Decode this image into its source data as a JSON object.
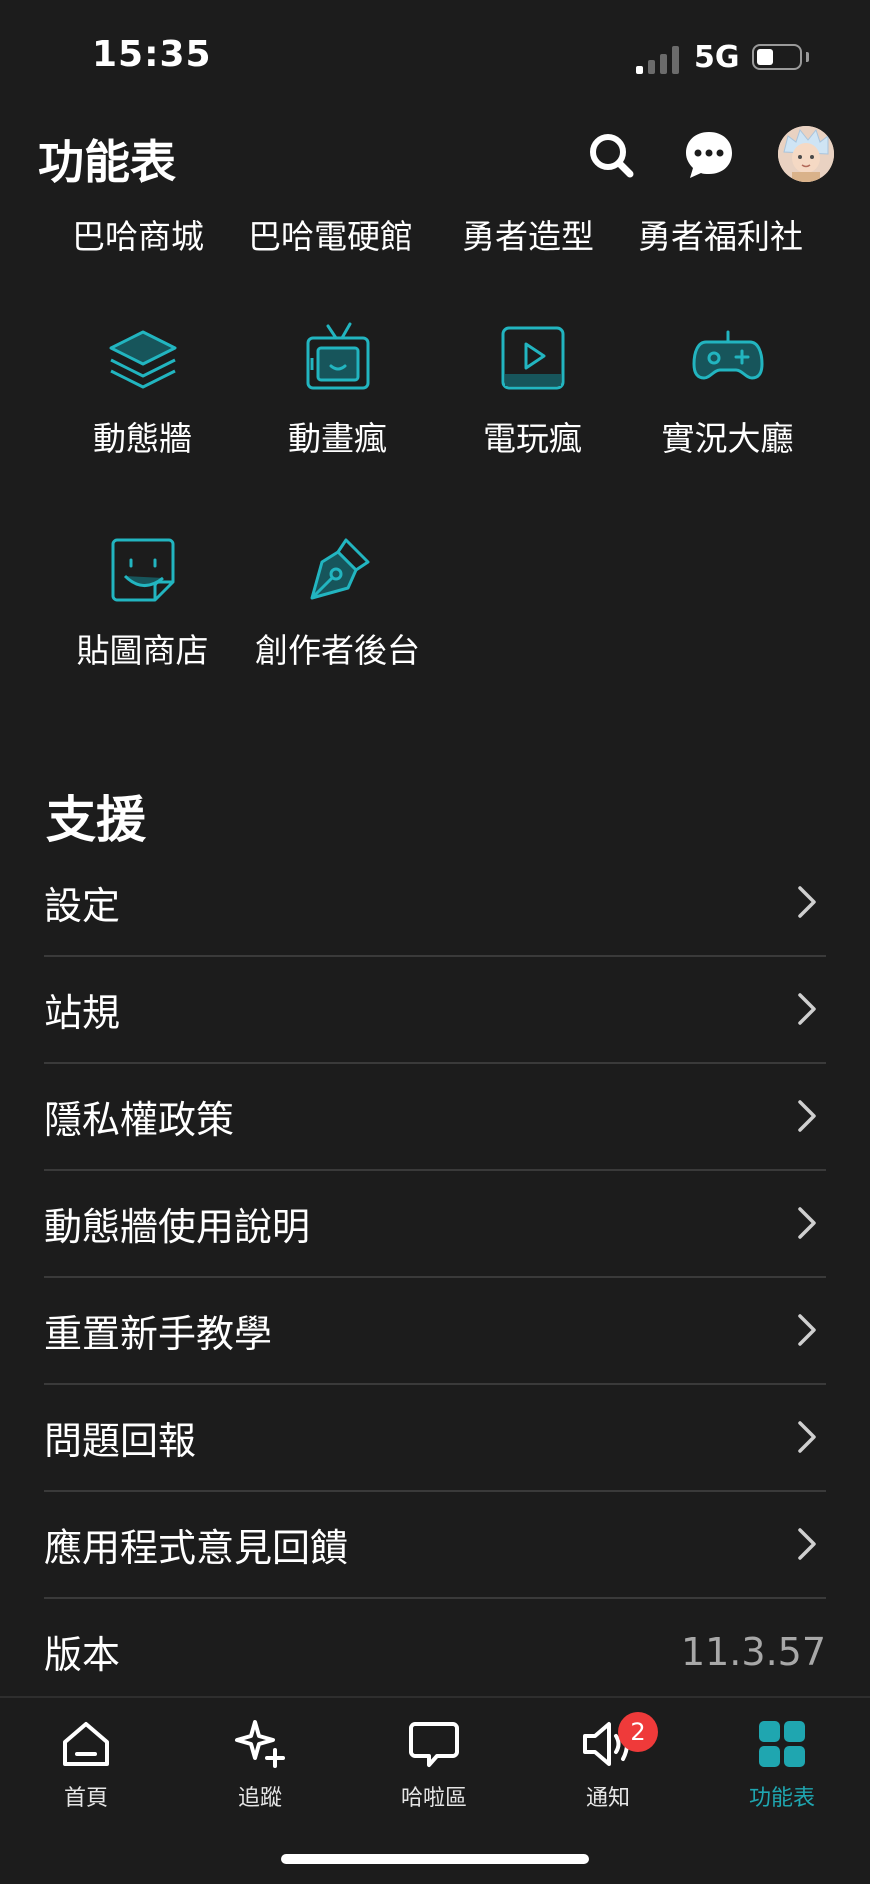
{
  "status_bar": {
    "time": "15:35",
    "network": "5G"
  },
  "header": {
    "title": "功能表"
  },
  "quick_links": [
    "巴哈商城",
    "巴哈電硬館",
    "勇者造型",
    "勇者福利社"
  ],
  "features": [
    {
      "label": "動態牆",
      "icon": "layers-icon"
    },
    {
      "label": "動畫瘋",
      "icon": "tv-icon"
    },
    {
      "label": "電玩瘋",
      "icon": "play-icon"
    },
    {
      "label": "實況大廳",
      "icon": "gamepad-icon"
    },
    {
      "label": "貼圖商店",
      "icon": "sticker-icon"
    },
    {
      "label": "創作者後台",
      "icon": "pen-nib-icon"
    }
  ],
  "support": {
    "title": "支援",
    "items": [
      "設定",
      "站規",
      "隱私權政策",
      "動態牆使用說明",
      "重置新手教學",
      "問題回報",
      "應用程式意見回饋"
    ],
    "version_label": "版本",
    "version_value": "11.3.57"
  },
  "tabs": [
    {
      "label": "首頁",
      "icon": "home-icon"
    },
    {
      "label": "追蹤",
      "icon": "sparkle-plus-icon"
    },
    {
      "label": "哈啦區",
      "icon": "chat-bubble-icon"
    },
    {
      "label": "通知",
      "icon": "speaker-icon",
      "badge": "2"
    },
    {
      "label": "功能表",
      "icon": "grid-icon",
      "active": true
    }
  ],
  "colors": {
    "accent": "#1fa6b0",
    "background": "#1c1c1c",
    "badge": "#ef3a3a"
  }
}
